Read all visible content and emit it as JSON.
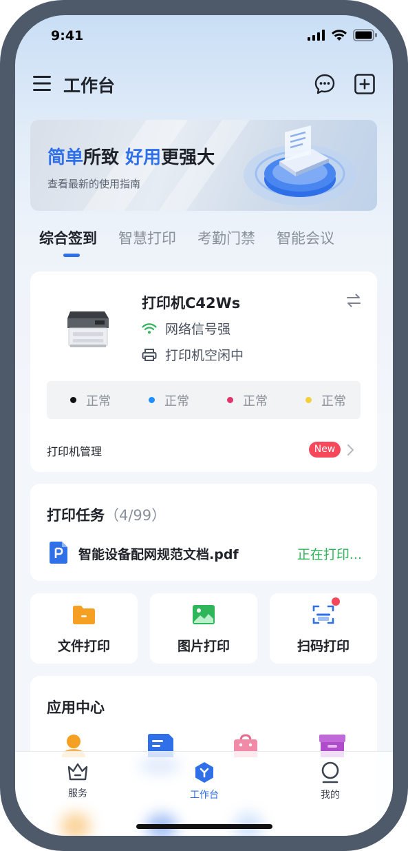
{
  "status_bar": {
    "time": "9:41"
  },
  "header": {
    "title": "工作台"
  },
  "banner": {
    "title_part1": "简单",
    "title_part2": "所致 ",
    "title_part3": "好用",
    "title_part4": "更强大",
    "subtitle": "查看最新的使用指南"
  },
  "tabs": [
    {
      "label": "综合签到",
      "active": true
    },
    {
      "label": "智慧打印",
      "active": false
    },
    {
      "label": "考勤门禁",
      "active": false
    },
    {
      "label": "智能会议",
      "active": false
    }
  ],
  "printer": {
    "name": "打印机C42Ws",
    "signal": "网络信号强",
    "state": "打印机空闲中",
    "inks": [
      {
        "status": "正常",
        "color": "#111111"
      },
      {
        "status": "正常",
        "color": "#1e8fff"
      },
      {
        "status": "正常",
        "color": "#e0356b"
      },
      {
        "status": "正常",
        "color": "#f2cf3c"
      }
    ],
    "management_label": "打印机管理",
    "badge": "New"
  },
  "tasks": {
    "title": "打印任务",
    "count": "（4/99）",
    "file_name": "智能设备配网规范文档.pdf",
    "file_status": "正在打印..."
  },
  "quick_actions": [
    {
      "label": "文件打印",
      "icon": "folder-icon",
      "color": "#f5a023"
    },
    {
      "label": "图片打印",
      "icon": "image-icon",
      "color": "#2fb55a"
    },
    {
      "label": "扫码打印",
      "icon": "scan-icon",
      "color": "#2f6fe8"
    }
  ],
  "app_center": {
    "title": "应用中心"
  },
  "bottom_nav": [
    {
      "label": "服务",
      "icon": "crown-icon"
    },
    {
      "label": "工作台",
      "icon": "workbench-icon"
    },
    {
      "label": "我的",
      "icon": "profile-icon"
    }
  ],
  "colors": {
    "accent": "#2f6fe8",
    "success": "#2fb55a",
    "badge": "#f5485a"
  }
}
